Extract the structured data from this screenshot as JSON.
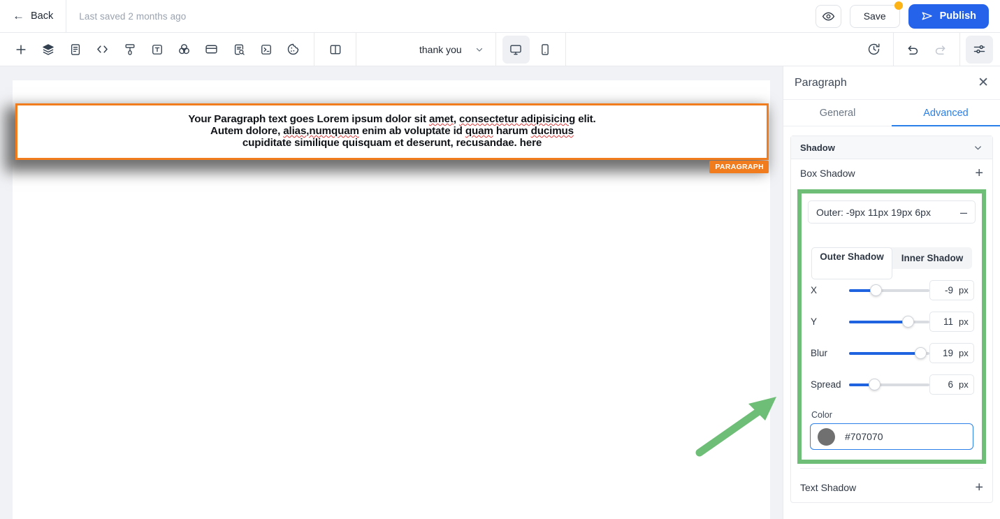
{
  "topbar": {
    "back_label": "Back",
    "back_icon": "arrow-left-icon",
    "saved_text": "Last saved 2 months ago",
    "preview_icon": "eye-icon",
    "save_label": "Save",
    "publish_label": "Publish",
    "publish_icon": "send-icon",
    "unsaved_badge_color": "#fcb316",
    "publish_color": "#2563eb"
  },
  "toolbar": {
    "left_tools": [
      {
        "name": "add-element-icon",
        "glyph": "plus"
      },
      {
        "name": "layers-icon",
        "glyph": "layers"
      },
      {
        "name": "pages-icon",
        "glyph": "document"
      },
      {
        "name": "code-icon",
        "glyph": "code"
      },
      {
        "name": "brush-icon",
        "glyph": "brush"
      },
      {
        "name": "text-icon",
        "glyph": "text-box"
      },
      {
        "name": "opacity-blend-icon",
        "glyph": "circles"
      },
      {
        "name": "card-icon",
        "glyph": "card"
      },
      {
        "name": "seo-inspect-icon",
        "glyph": "doc-search"
      },
      {
        "name": "terminal-icon",
        "glyph": "terminal"
      },
      {
        "name": "cookie-icon",
        "glyph": "cookie"
      }
    ],
    "split_view_icon": "split-panel-icon",
    "page_name": "thank you",
    "page_chevron_icon": "chevron-down-icon",
    "device_desktop_icon": "desktop-icon",
    "device_mobile_icon": "mobile-icon",
    "active_device": "desktop",
    "history_icon": "history-clock-icon",
    "undo_icon": "undo-icon",
    "redo_icon": "redo-icon",
    "settings_icon": "settings-sliders-icon"
  },
  "canvas": {
    "paragraph": {
      "line1_a": "Your Paragraph text goes Lorem ipsum dolor sit ",
      "line1_b": "amet",
      "line1_c": ", ",
      "line1_d": "consectetur adipisicing",
      "line1_e": " elit.",
      "line2_a": "Autem dolore, ",
      "line2_b": "alias,numquam",
      "line2_c": " enim ab voluptate id ",
      "line2_d": "quam",
      "line2_e": " harum ",
      "line2_f": "ducimus",
      "line3": "cupiditate similique quisquam et deserunt, recusandae. here",
      "badge_label": "PARAGRAPH",
      "border_color": "#f07c1e",
      "badge_color": "#f07c1e",
      "shadow_css": "-9px 11px 19px 6px #707070"
    },
    "annotation_arrow_color": "#6ebe78"
  },
  "panel": {
    "title": "Paragraph",
    "close_icon": "close-icon",
    "tabs": [
      {
        "label": "General",
        "active": false
      },
      {
        "label": "Advanced",
        "active": true
      }
    ],
    "accent_color": "#2a7fe8",
    "highlight_color": "#6ebe78",
    "shadow_section": {
      "header": "Shadow",
      "chevron_icon": "chevron-down-icon",
      "box_shadow_label": "Box Shadow",
      "add_icon": "plus-icon",
      "entry_title": "Outer: -9px 11px 19px 6px",
      "collapse_icon": "minus-icon",
      "segments": [
        {
          "label": "Outer Shadow",
          "active": true
        },
        {
          "label": "Inner Shadow",
          "active": false
        }
      ],
      "sliders": [
        {
          "label": "X",
          "value": "-9",
          "unit": "px",
          "fill_pct": 33,
          "thumb_pct": 33
        },
        {
          "label": "Y",
          "value": "11",
          "unit": "px",
          "fill_pct": 73,
          "thumb_pct": 73
        },
        {
          "label": "Blur",
          "value": "19",
          "unit": "px",
          "fill_pct": 89,
          "thumb_pct": 89
        },
        {
          "label": "Spread",
          "value": "6",
          "unit": "px",
          "fill_pct": 32,
          "thumb_pct": 32
        }
      ],
      "color_label": "Color",
      "color_value": "#707070",
      "color_swatch": "#707070"
    },
    "text_shadow_label": "Text Shadow",
    "text_shadow_add_icon": "plus-icon"
  }
}
